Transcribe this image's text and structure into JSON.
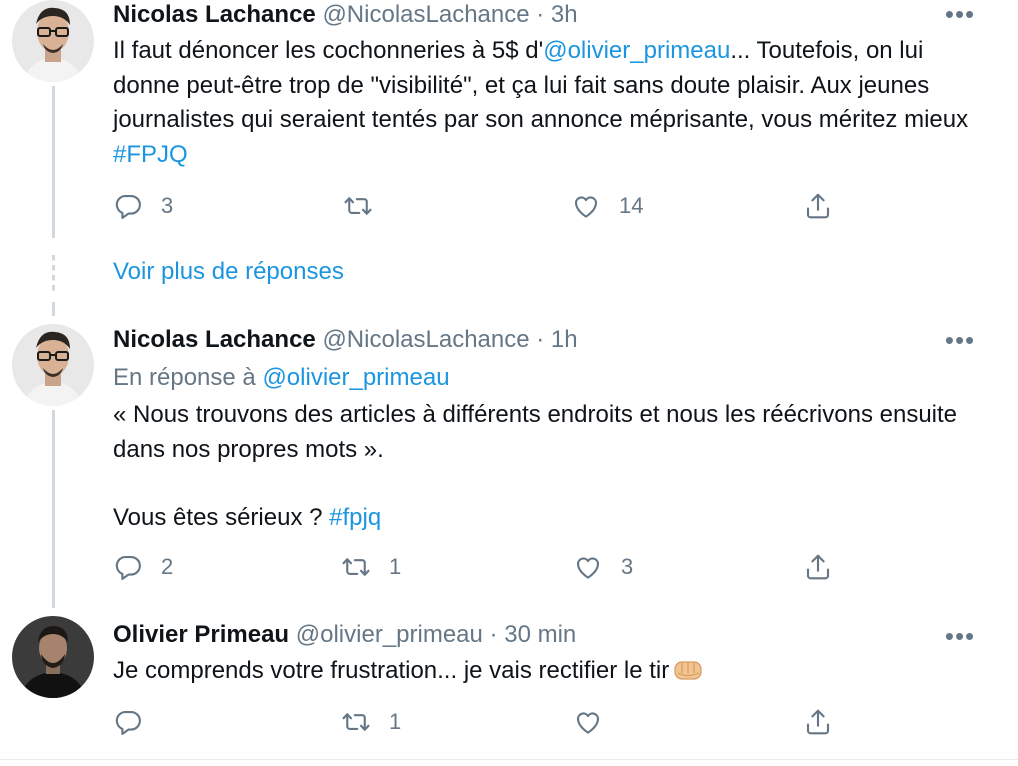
{
  "tweets": [
    {
      "author_name": "Nicolas Lachance",
      "handle": "@NicolasLachance",
      "separator": "·",
      "time": "3h",
      "text_parts": [
        "Il faut dénoncer les cochonneries à 5$ d'",
        "@olivier_primeau",
        "... Toutefois, on lui donne peut-être trop de \"visibilité\", et ça lui fait sans doute plaisir. Aux jeunes journalistes qui seraient tentés par son annonce méprisante, vous méritez mieux ",
        "#FPJQ"
      ],
      "reply_count": "3",
      "retweet_count": "",
      "like_count": "14"
    },
    {
      "author_name": "Nicolas Lachance",
      "handle": "@NicolasLachance",
      "separator": "·",
      "time": "1h",
      "reply_to_label": "En réponse à ",
      "reply_to_handle": "@olivier_primeau",
      "text_line1": "« Nous trouvons des articles à différents endroits et nous les réécrivons ensuite dans nos propres mots ».",
      "text_line2": "Vous êtes sérieux ? ",
      "hashtag": "#fpjq",
      "reply_count": "2",
      "retweet_count": "1",
      "like_count": "3"
    },
    {
      "author_name": "Olivier Primeau",
      "handle": "@olivier_primeau",
      "separator": "·",
      "time": "30 min",
      "text": "Je comprends votre frustration... je vais rectifier le tir",
      "emoji_name": "oncoming-fist-emoji",
      "reply_count": "",
      "retweet_count": "1",
      "like_count": ""
    }
  ],
  "more_replies_label": "Voir plus de réponses",
  "more_menu_glyph": "•••",
  "colors": {
    "link": "#1b95e0",
    "secondary": "#657786",
    "thread_line": "#cfd9de"
  },
  "icons": [
    "reply-icon",
    "retweet-icon",
    "like-icon",
    "share-icon",
    "more-options-icon"
  ]
}
